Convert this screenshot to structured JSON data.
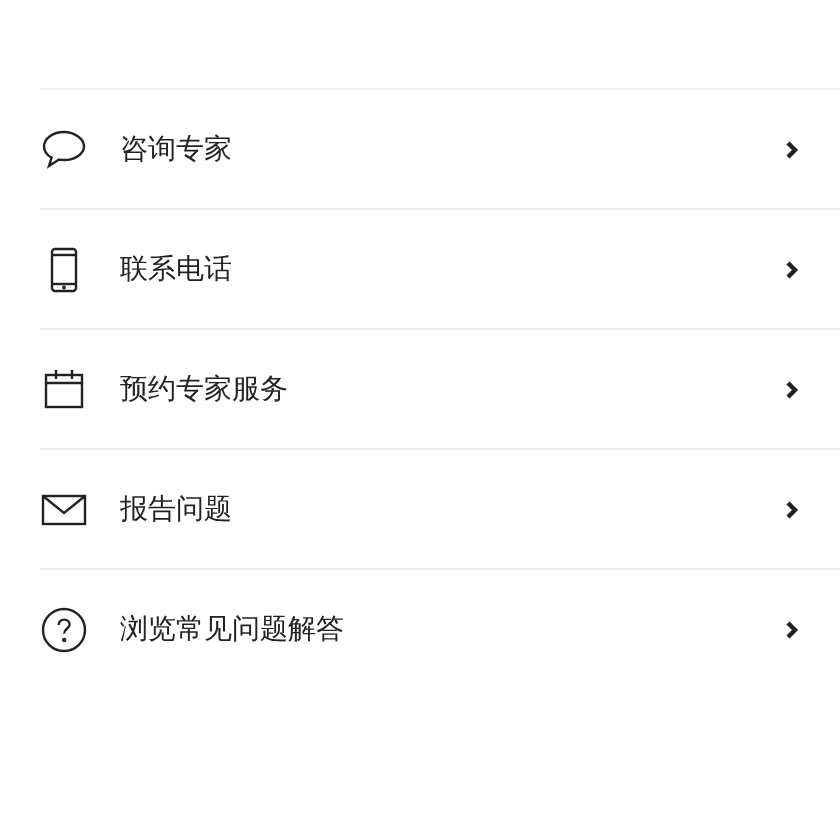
{
  "menu": {
    "items": [
      {
        "kind": "chat",
        "label": "咨询专家"
      },
      {
        "kind": "phone",
        "label": "联系电话"
      },
      {
        "kind": "calendar",
        "label": "预约专家服务"
      },
      {
        "kind": "mail",
        "label": "报告问题"
      },
      {
        "kind": "help",
        "label": "浏览常见问题解答"
      }
    ]
  }
}
